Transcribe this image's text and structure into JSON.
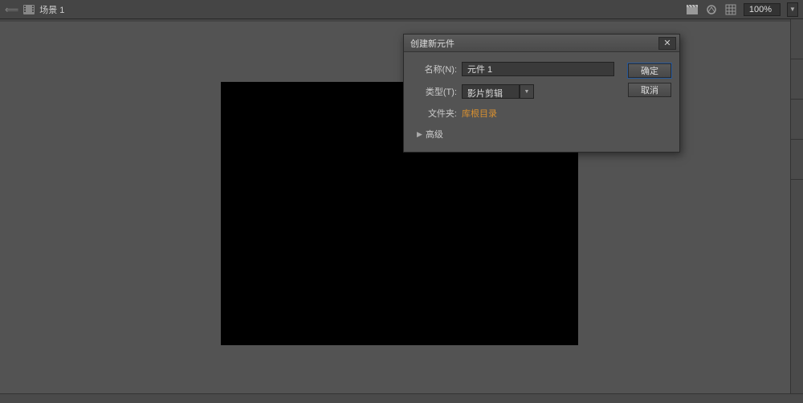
{
  "topbar": {
    "scene_label": "场景 1",
    "zoom": "100%"
  },
  "dialog": {
    "title": "创建新元件",
    "name_label": "名称(N):",
    "name_value": "元件 1",
    "type_label": "类型(T):",
    "type_value": "影片剪辑",
    "folder_label": "文件夹:",
    "folder_link": "库根目录",
    "advanced_label": "高级",
    "ok_label": "确定",
    "cancel_label": "取消"
  }
}
